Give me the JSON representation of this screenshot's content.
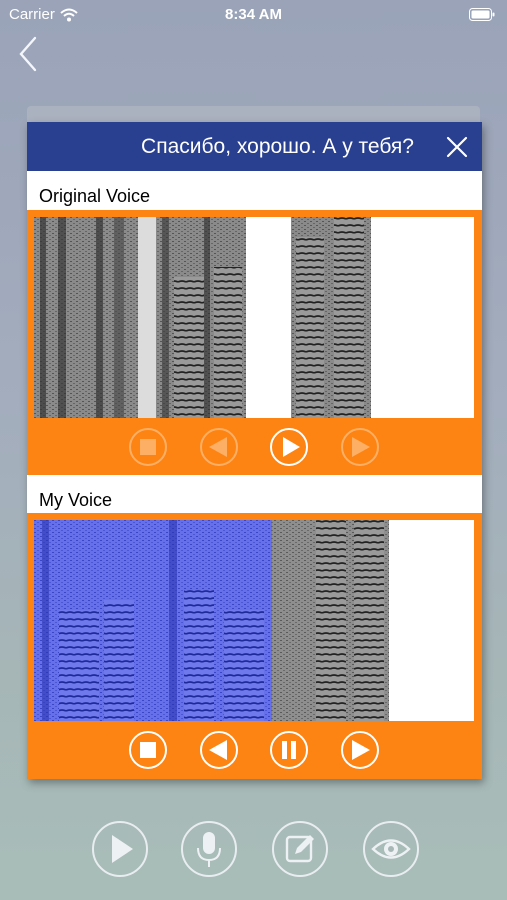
{
  "status_bar": {
    "carrier": "Carrier",
    "time": "8:34 AM"
  },
  "dialog": {
    "title": "Спасибо, хорошо. А у тебя?",
    "original_label": "Original Voice",
    "my_label": "My Voice"
  },
  "original_controls": {
    "stop": "stop-icon",
    "rewind": "rewind-icon",
    "play": "play-icon",
    "forward": "forward-icon",
    "enabled": [
      "play"
    ]
  },
  "my_controls": {
    "stop": "stop-icon",
    "rewind": "rewind-icon",
    "pause": "pause-icon",
    "forward": "forward-icon"
  },
  "toolbar": [
    "play-icon",
    "microphone-icon",
    "edit-icon",
    "eye-icon"
  ],
  "colors": {
    "header": "#293f8f",
    "panel": "#fd8412",
    "spectrogram_recorded": "#4a55e0",
    "spectrogram_gray": "#555555"
  }
}
